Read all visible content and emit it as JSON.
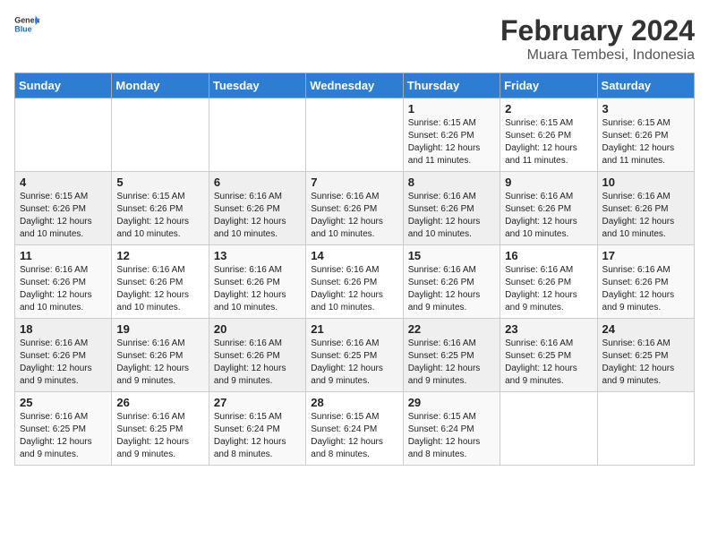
{
  "logo": {
    "general": "General",
    "blue": "Blue"
  },
  "title": "February 2024",
  "subtitle": "Muara Tembesi, Indonesia",
  "days": [
    "Sunday",
    "Monday",
    "Tuesday",
    "Wednesday",
    "Thursday",
    "Friday",
    "Saturday"
  ],
  "weeks": [
    [
      {
        "num": "",
        "text": ""
      },
      {
        "num": "",
        "text": ""
      },
      {
        "num": "",
        "text": ""
      },
      {
        "num": "",
        "text": ""
      },
      {
        "num": "1",
        "text": "Sunrise: 6:15 AM\nSunset: 6:26 PM\nDaylight: 12 hours and 11 minutes."
      },
      {
        "num": "2",
        "text": "Sunrise: 6:15 AM\nSunset: 6:26 PM\nDaylight: 12 hours and 11 minutes."
      },
      {
        "num": "3",
        "text": "Sunrise: 6:15 AM\nSunset: 6:26 PM\nDaylight: 12 hours and 11 minutes."
      }
    ],
    [
      {
        "num": "4",
        "text": "Sunrise: 6:15 AM\nSunset: 6:26 PM\nDaylight: 12 hours and 10 minutes."
      },
      {
        "num": "5",
        "text": "Sunrise: 6:15 AM\nSunset: 6:26 PM\nDaylight: 12 hours and 10 minutes."
      },
      {
        "num": "6",
        "text": "Sunrise: 6:16 AM\nSunset: 6:26 PM\nDaylight: 12 hours and 10 minutes."
      },
      {
        "num": "7",
        "text": "Sunrise: 6:16 AM\nSunset: 6:26 PM\nDaylight: 12 hours and 10 minutes."
      },
      {
        "num": "8",
        "text": "Sunrise: 6:16 AM\nSunset: 6:26 PM\nDaylight: 12 hours and 10 minutes."
      },
      {
        "num": "9",
        "text": "Sunrise: 6:16 AM\nSunset: 6:26 PM\nDaylight: 12 hours and 10 minutes."
      },
      {
        "num": "10",
        "text": "Sunrise: 6:16 AM\nSunset: 6:26 PM\nDaylight: 12 hours and 10 minutes."
      }
    ],
    [
      {
        "num": "11",
        "text": "Sunrise: 6:16 AM\nSunset: 6:26 PM\nDaylight: 12 hours and 10 minutes."
      },
      {
        "num": "12",
        "text": "Sunrise: 6:16 AM\nSunset: 6:26 PM\nDaylight: 12 hours and 10 minutes."
      },
      {
        "num": "13",
        "text": "Sunrise: 6:16 AM\nSunset: 6:26 PM\nDaylight: 12 hours and 10 minutes."
      },
      {
        "num": "14",
        "text": "Sunrise: 6:16 AM\nSunset: 6:26 PM\nDaylight: 12 hours and 10 minutes."
      },
      {
        "num": "15",
        "text": "Sunrise: 6:16 AM\nSunset: 6:26 PM\nDaylight: 12 hours and 9 minutes."
      },
      {
        "num": "16",
        "text": "Sunrise: 6:16 AM\nSunset: 6:26 PM\nDaylight: 12 hours and 9 minutes."
      },
      {
        "num": "17",
        "text": "Sunrise: 6:16 AM\nSunset: 6:26 PM\nDaylight: 12 hours and 9 minutes."
      }
    ],
    [
      {
        "num": "18",
        "text": "Sunrise: 6:16 AM\nSunset: 6:26 PM\nDaylight: 12 hours and 9 minutes."
      },
      {
        "num": "19",
        "text": "Sunrise: 6:16 AM\nSunset: 6:26 PM\nDaylight: 12 hours and 9 minutes."
      },
      {
        "num": "20",
        "text": "Sunrise: 6:16 AM\nSunset: 6:26 PM\nDaylight: 12 hours and 9 minutes."
      },
      {
        "num": "21",
        "text": "Sunrise: 6:16 AM\nSunset: 6:25 PM\nDaylight: 12 hours and 9 minutes."
      },
      {
        "num": "22",
        "text": "Sunrise: 6:16 AM\nSunset: 6:25 PM\nDaylight: 12 hours and 9 minutes."
      },
      {
        "num": "23",
        "text": "Sunrise: 6:16 AM\nSunset: 6:25 PM\nDaylight: 12 hours and 9 minutes."
      },
      {
        "num": "24",
        "text": "Sunrise: 6:16 AM\nSunset: 6:25 PM\nDaylight: 12 hours and 9 minutes."
      }
    ],
    [
      {
        "num": "25",
        "text": "Sunrise: 6:16 AM\nSunset: 6:25 PM\nDaylight: 12 hours and 9 minutes."
      },
      {
        "num": "26",
        "text": "Sunrise: 6:16 AM\nSunset: 6:25 PM\nDaylight: 12 hours and 9 minutes."
      },
      {
        "num": "27",
        "text": "Sunrise: 6:15 AM\nSunset: 6:24 PM\nDaylight: 12 hours and 8 minutes."
      },
      {
        "num": "28",
        "text": "Sunrise: 6:15 AM\nSunset: 6:24 PM\nDaylight: 12 hours and 8 minutes."
      },
      {
        "num": "29",
        "text": "Sunrise: 6:15 AM\nSunset: 6:24 PM\nDaylight: 12 hours and 8 minutes."
      },
      {
        "num": "",
        "text": ""
      },
      {
        "num": "",
        "text": ""
      }
    ]
  ]
}
